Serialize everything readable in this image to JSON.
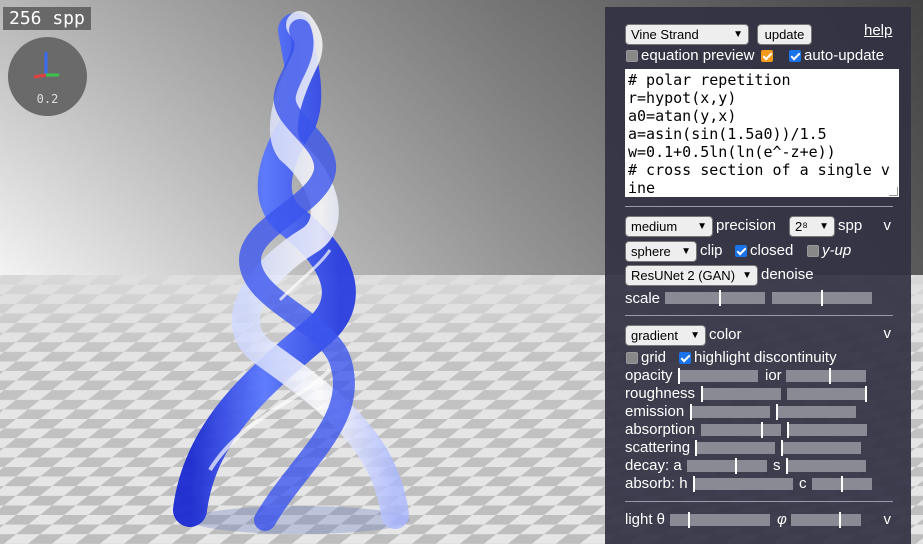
{
  "render": {
    "spp_label": "256 spp",
    "axes_scale": "0.2"
  },
  "toolbar": {
    "preset": "Vine Strand",
    "update_label": "update",
    "help_label": "help",
    "equation_preview_label": "equation preview",
    "auto_update_label": "auto-update"
  },
  "code": {
    "text": "# polar repetition\nr=hypot(x,y)\na0=atan(y,x)\na=asin(sin(1.5a0))/1.5\nw=0.1+0.5ln(ln(e^-z+e))\n# cross section of a single vine"
  },
  "render_settings": {
    "precision_value": "medium",
    "precision_label": "precision",
    "spp_value": "2⁸",
    "spp_label": "spp",
    "clip_value": "sphere",
    "clip_label": "clip",
    "closed_label": "closed",
    "yup_label": "y-up",
    "denoise_value": "ResUNet 2 (GAN)",
    "denoise_label": "denoise",
    "scale_label": "scale",
    "collapse": "v"
  },
  "material": {
    "color_value": "gradient",
    "color_label": "color",
    "grid_label": "grid",
    "highlight_label": "highlight discontinuity",
    "opacity_label": "opacity",
    "ior_label": "ior",
    "roughness_label": "roughness",
    "emission_label": "emission",
    "absorption_label": "absorption",
    "scattering_label": "scattering",
    "decay_label": "decay: a",
    "decay_s_label": "s",
    "absorb_label": "absorb: h",
    "absorb_c_label": "c",
    "collapse": "v"
  },
  "light": {
    "theta_label": "light θ",
    "phi_label": "φ",
    "collapse": "v"
  },
  "sliders": {
    "scale_a": 0.55,
    "scale_b": 0.5,
    "opacity": 0.0,
    "ior": 0.55,
    "roughness_a": 0.0,
    "roughness_b": 1.0,
    "emission_a": 0.0,
    "emission_b": 0.0,
    "absorption_a": 0.77,
    "absorption_b": 0.0,
    "scattering_a": 0.0,
    "scattering_b": 0.0,
    "decay_a": 0.62,
    "decay_s": 0.0,
    "absorb_h": 0.0,
    "absorb_c": 0.5,
    "theta": 0.18,
    "phi": 0.71
  },
  "colors": {
    "panel_bg": "#32324a",
    "checkbox_blue": "#1a73e8",
    "checkbox_orange": "#f59b1b",
    "sculpture_blue": "#2a3fe0"
  }
}
